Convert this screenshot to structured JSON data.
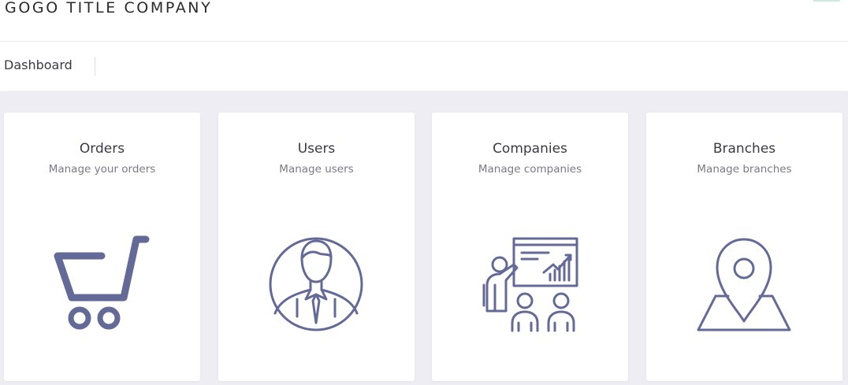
{
  "header": {
    "company_name": "GOGO TITLE COMPANY"
  },
  "breadcrumb": {
    "title": "Dashboard"
  },
  "colors": {
    "icon": "#646a98",
    "background": "#ededf3",
    "card": "#ffffff"
  },
  "cards": [
    {
      "title": "Orders",
      "subtitle": "Manage your orders",
      "icon": "shopping-cart-icon"
    },
    {
      "title": "Users",
      "subtitle": "Manage users",
      "icon": "user-avatar-icon"
    },
    {
      "title": "Companies",
      "subtitle": "Manage companies",
      "icon": "presentation-icon"
    },
    {
      "title": "Branches",
      "subtitle": "Manage branches",
      "icon": "map-pin-icon"
    }
  ]
}
